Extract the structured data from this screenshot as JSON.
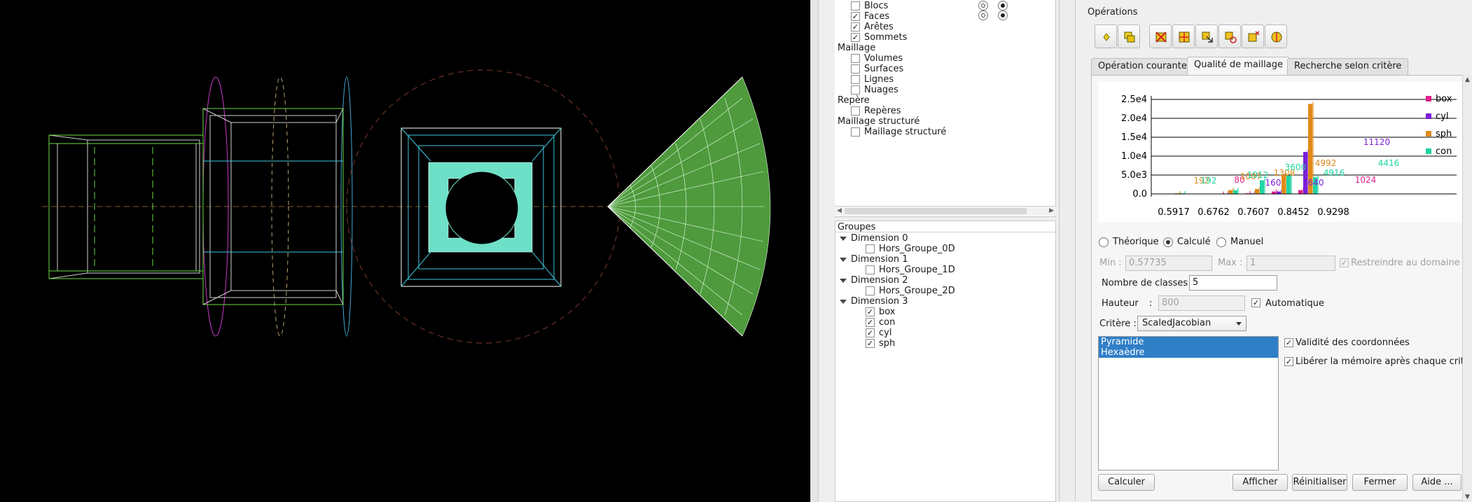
{
  "tree": {
    "items": [
      {
        "label": "Blocs",
        "checked": false,
        "indent": 1
      },
      {
        "label": "Faces",
        "checked": true,
        "indent": 1
      },
      {
        "label": "Arêtes",
        "checked": true,
        "indent": 1
      },
      {
        "label": "Sommets",
        "checked": true,
        "indent": 1
      },
      {
        "label": "Maillage",
        "checked": null,
        "indent": 0
      },
      {
        "label": "Volumes",
        "checked": false,
        "indent": 1
      },
      {
        "label": "Surfaces",
        "checked": false,
        "indent": 1
      },
      {
        "label": "Lignes",
        "checked": false,
        "indent": 1
      },
      {
        "label": "Nuages",
        "checked": false,
        "indent": 1
      },
      {
        "label": "Repère",
        "checked": null,
        "indent": 0
      },
      {
        "label": "Repères",
        "checked": false,
        "indent": 1
      },
      {
        "label": "Maillage structuré",
        "checked": null,
        "indent": 0
      },
      {
        "label": "Maillage structuré",
        "checked": false,
        "indent": 1
      }
    ]
  },
  "groups": {
    "title": "Groupes",
    "items": [
      {
        "label": "Dimension 0",
        "type": "parent"
      },
      {
        "label": "Hors_Groupe_0D",
        "type": "child",
        "checked": false
      },
      {
        "label": "Dimension 1",
        "type": "parent"
      },
      {
        "label": "Hors_Groupe_1D",
        "type": "child",
        "checked": false
      },
      {
        "label": "Dimension 2",
        "type": "parent"
      },
      {
        "label": "Hors_Groupe_2D",
        "type": "child",
        "checked": false
      },
      {
        "label": "Dimension 3",
        "type": "parent"
      },
      {
        "label": "box",
        "type": "child",
        "checked": true
      },
      {
        "label": "con",
        "type": "child",
        "checked": true
      },
      {
        "label": "cyl",
        "type": "child",
        "checked": true
      },
      {
        "label": "sph",
        "type": "child",
        "checked": true
      }
    ]
  },
  "operations": {
    "title": "Opérations",
    "tools": [
      "point-icon",
      "copy-blocks-icon",
      "delete-icon",
      "split-icon",
      "select-arrow-icon",
      "rotate-icon",
      "snap-icon",
      "sphere-icon"
    ],
    "tabs": [
      "Opération courante",
      "Qualité de maillage",
      "Recherche selon critère"
    ],
    "active_tab": 1
  },
  "chart_data": {
    "type": "bar",
    "categories": [
      "0.5917",
      "0.6762",
      "0.7607",
      "0.8452",
      "0.9298"
    ],
    "yticks": [
      "2.5e4",
      "2.0e4",
      "1.5e4",
      "1.0e4",
      "5.0e3",
      "0.0"
    ],
    "ylim": [
      0,
      25000
    ],
    "series": [
      {
        "name": "box",
        "color": "#e0208c",
        "values": [
          0,
          0,
          80,
          160,
          640,
          1024
        ]
      },
      {
        "name": "cyl",
        "color": "#7b1fd8",
        "values": [
          0,
          0,
          80,
          160,
          640,
          11120
        ]
      },
      {
        "name": "sph",
        "color": "#e08a18",
        "values": [
          192,
          0,
          1007,
          1308,
          4992,
          23800
        ]
      },
      {
        "name": "con",
        "color": "#20d4a0",
        "values": [
          192,
          0,
          1012,
          3600,
          4916,
          4416
        ]
      }
    ],
    "data_labels": [
      {
        "text": "192",
        "series": "sph"
      },
      {
        "text": "192",
        "series": "con"
      },
      {
        "text": "80",
        "series": "box"
      },
      {
        "text": "1007",
        "series": "sph"
      },
      {
        "text": "1012",
        "series": "con"
      },
      {
        "text": "160",
        "series": "cyl"
      },
      {
        "text": "1308",
        "series": "sph"
      },
      {
        "text": "3600",
        "series": "con"
      },
      {
        "text": "640",
        "series": "cyl"
      },
      {
        "text": "4992",
        "series": "sph"
      },
      {
        "text": "4916",
        "series": "con"
      },
      {
        "text": "1024",
        "series": "box"
      },
      {
        "text": "11120",
        "series": "cyl"
      },
      {
        "text": "4416",
        "series": "con"
      }
    ]
  },
  "quality": {
    "mode_options": [
      "Théorique",
      "Calculé",
      "Manuel"
    ],
    "mode_selected": "Calculé",
    "min_label": "Min :",
    "min_value": "0.57735",
    "max_label": "Max :",
    "max_value": "1",
    "restrict_label": "Restreindre au domaine",
    "classes_label": "Nombre de classes :",
    "classes_value": "5",
    "height_label": "Hauteur",
    "height_colon": ":",
    "height_value": "800",
    "auto_label": "Automatique",
    "criteria_label": "Critère :",
    "criteria_value": "ScaledJacobian",
    "list_items": [
      "Pyramide",
      "Hexaèdre"
    ],
    "validity_label": "Validité des coordonnées",
    "free_memory_label": "Libérer la mémoire après chaque critère",
    "buttons": {
      "calculate": "Calculer",
      "display": "Afficher",
      "reset": "Réinitialiser",
      "close": "Fermer",
      "help": "Aide ..."
    }
  }
}
